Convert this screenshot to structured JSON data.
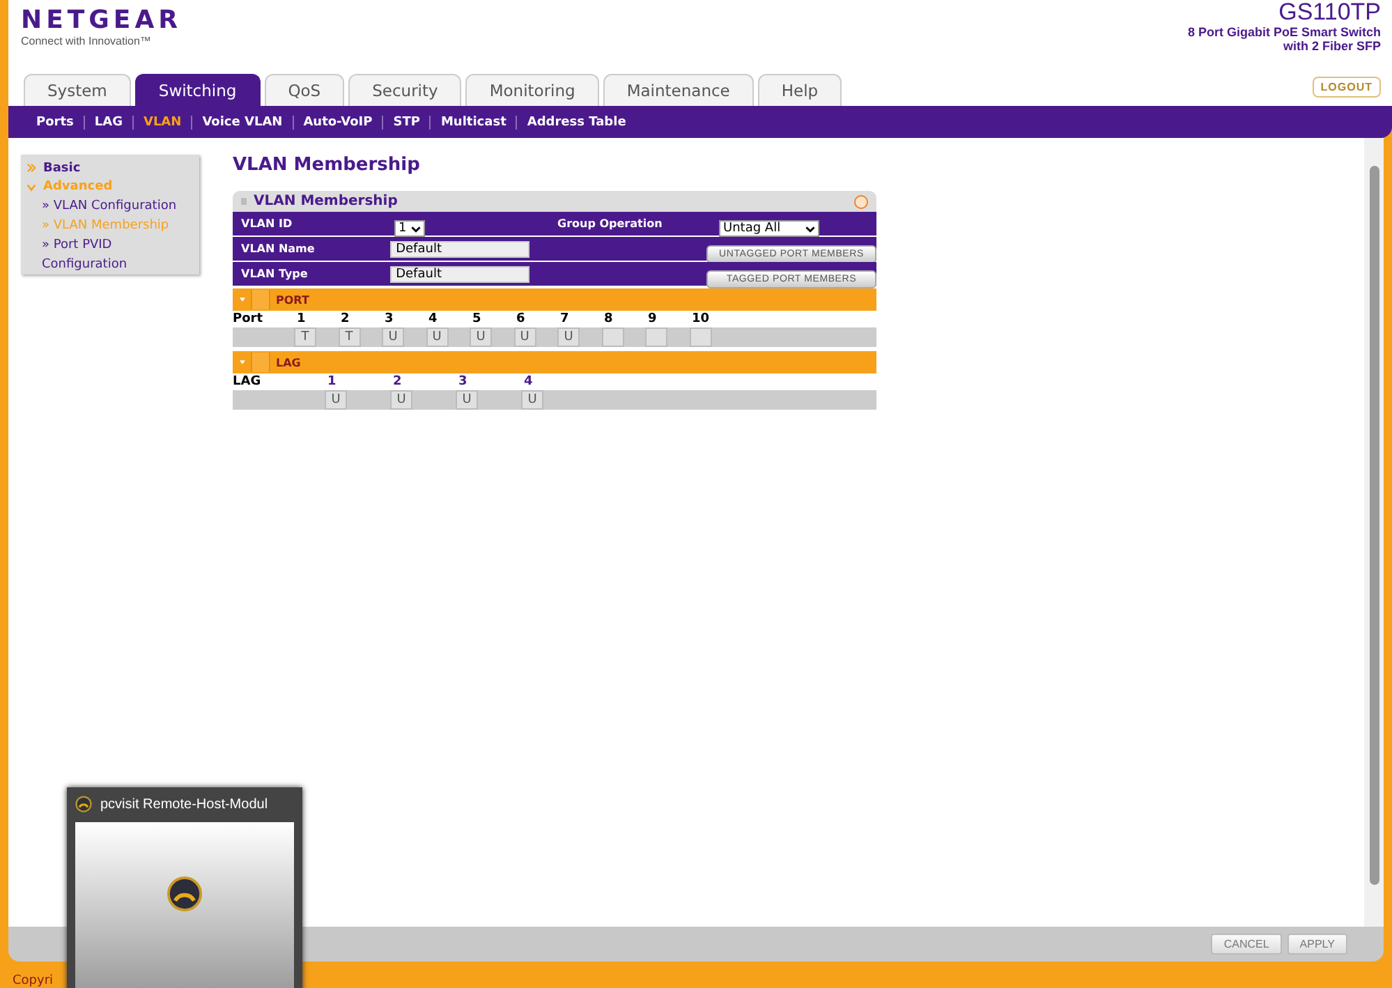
{
  "brand": {
    "logo": "NETGEAR",
    "tagline": "Connect with Innovation™"
  },
  "product": {
    "model": "GS110TP",
    "description_lines": [
      "8 Port Gigabit PoE Smart Switch",
      "with 2 Fiber SFP"
    ]
  },
  "logout": "LOGOUT",
  "tabs": [
    {
      "label": "System",
      "selected": false
    },
    {
      "label": "Switching",
      "selected": true
    },
    {
      "label": "QoS",
      "selected": false
    },
    {
      "label": "Security",
      "selected": false
    },
    {
      "label": "Monitoring",
      "selected": false
    },
    {
      "label": "Maintenance",
      "selected": false
    },
    {
      "label": "Help",
      "selected": false
    }
  ],
  "subnav": [
    {
      "label": "Ports",
      "selected": false
    },
    {
      "label": "LAG",
      "selected": false
    },
    {
      "label": "VLAN",
      "selected": true
    },
    {
      "label": "Voice VLAN",
      "selected": false
    },
    {
      "label": "Auto-VoIP",
      "selected": false
    },
    {
      "label": "STP",
      "selected": false
    },
    {
      "label": "Multicast",
      "selected": false
    },
    {
      "label": "Address Table",
      "selected": false
    }
  ],
  "sidebar": {
    "items": [
      {
        "label": "Basic",
        "expanded": false
      },
      {
        "label": "Advanced",
        "expanded": true,
        "children": [
          {
            "label": "» VLAN Configuration",
            "selected": false
          },
          {
            "label": "» VLAN Membership",
            "selected": true
          },
          {
            "label": "» Port PVID Configuration",
            "selected": false
          }
        ]
      }
    ]
  },
  "page_title": "VLAN Membership",
  "panel": {
    "title": "VLAN Membership",
    "fields": [
      {
        "kind": "select",
        "label": "VLAN ID",
        "value": "1",
        "action": {
          "label": "Group Operation",
          "kind": "select",
          "value": "Untag All"
        }
      },
      {
        "kind": "input",
        "label": "VLAN Name",
        "value": "Default",
        "action": {
          "kind": "button",
          "value": "UNTAGGED PORT MEMBERS"
        }
      },
      {
        "kind": "input",
        "label": "VLAN Type",
        "value": "Default",
        "action": {
          "kind": "button",
          "value": "TAGGED PORT MEMBERS"
        }
      }
    ],
    "sections": [
      {
        "title": "PORT",
        "expanded": true,
        "row_label": "Port",
        "kind": "port",
        "items": [
          {
            "label": "1",
            "value": "T"
          },
          {
            "label": "2",
            "value": "T"
          },
          {
            "label": "3",
            "value": "U"
          },
          {
            "label": "4",
            "value": "U"
          },
          {
            "label": "5",
            "value": "U"
          },
          {
            "label": "6",
            "value": "U"
          },
          {
            "label": "7",
            "value": "U"
          },
          {
            "label": "8"
          },
          {
            "label": "9"
          },
          {
            "label": "10"
          }
        ]
      },
      {
        "title": "LAG",
        "expanded": true,
        "row_label": "LAG",
        "kind": "lag",
        "items": [
          {
            "label": "1",
            "value": "U"
          },
          {
            "label": "2",
            "value": "U"
          },
          {
            "label": "3",
            "value": "U"
          },
          {
            "label": "4",
            "value": "U"
          }
        ]
      }
    ]
  },
  "footer_buttons": [
    "CANCEL",
    "APPLY"
  ],
  "copyright": "Copyri",
  "overlay_window": {
    "title": "pcvisit Remote-Host-Modul"
  }
}
